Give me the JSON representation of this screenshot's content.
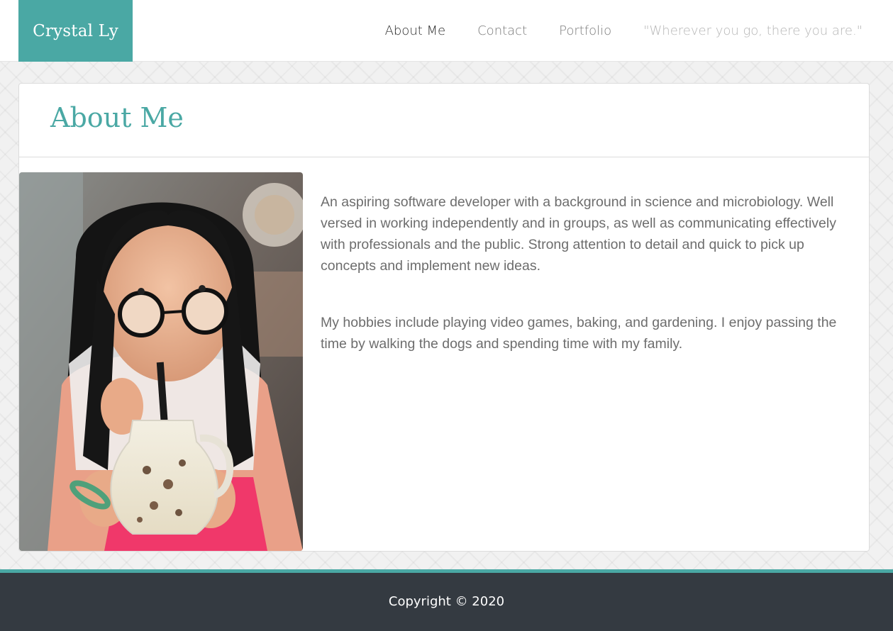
{
  "header": {
    "brand": "Crystal Ly",
    "nav": [
      {
        "label": "About Me"
      },
      {
        "label": "Contact"
      },
      {
        "label": "Portfolio"
      }
    ],
    "quote": "\"Wherever you go, there you are.\""
  },
  "about": {
    "title": "About Me",
    "paragraphs": [
      "An aspiring software developer with a background in science and microbiology. Well versed in working independently and in groups, as well as communicating effectively with professionals and the public. Strong attention to detail and quick to pick up concepts and implement new ideas.",
      "My hobbies include playing video games, baking, and gardening. I enjoy passing the time by walking the dogs and spending time with my family."
    ]
  },
  "footer": {
    "copyright": "Copyright © 2020"
  },
  "colors": {
    "accent": "#4aa8a4",
    "footer_bg": "#343a41",
    "body_text": "#6d6d6d"
  }
}
